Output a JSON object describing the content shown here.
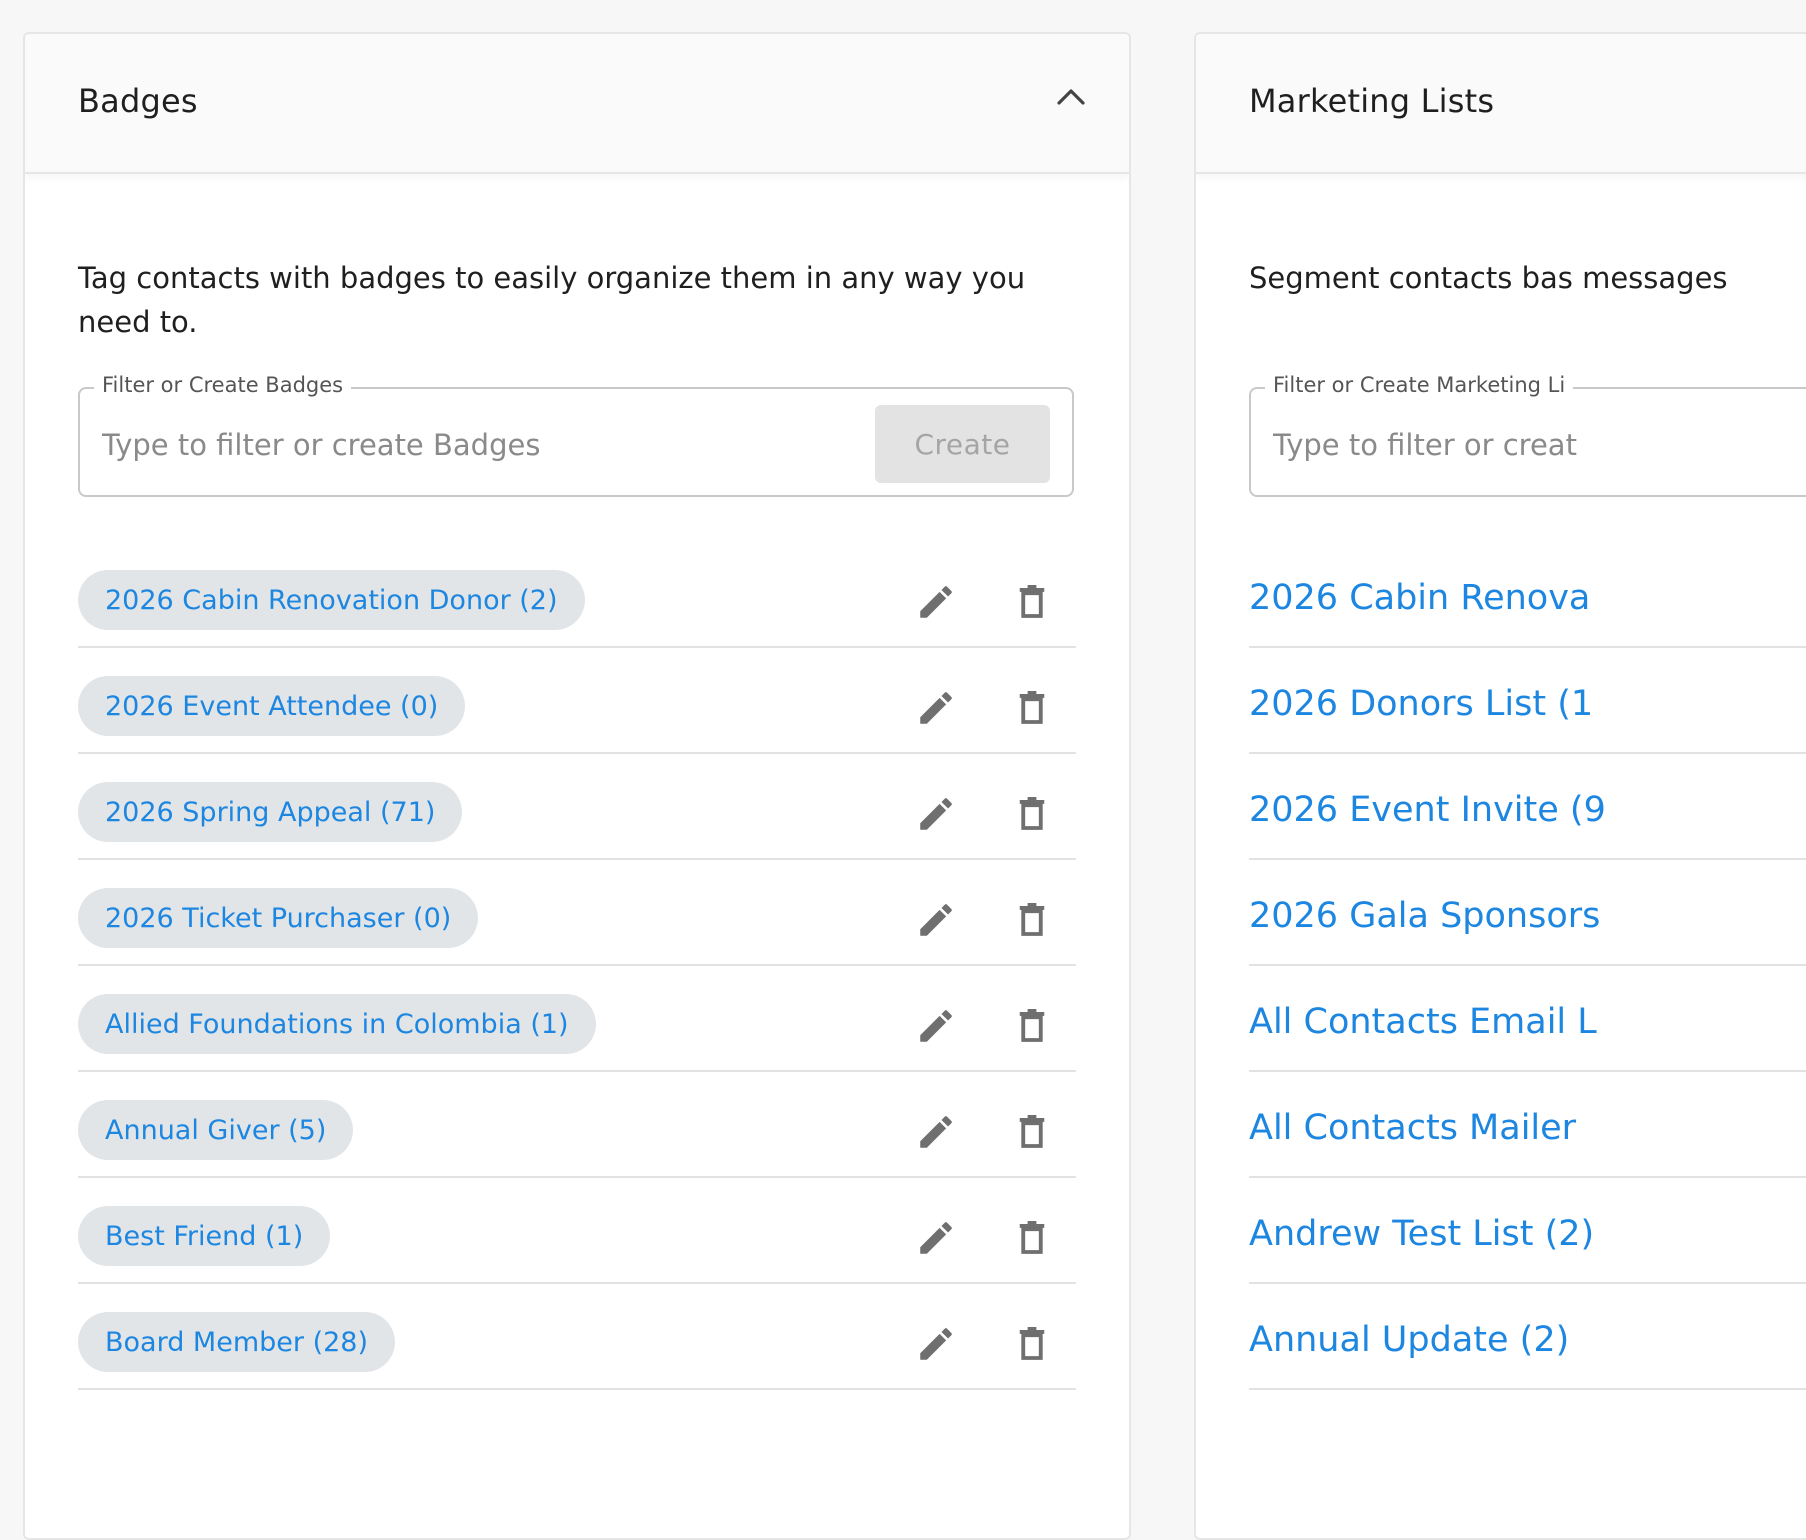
{
  "badges_panel": {
    "title": "Badges",
    "description": "Tag contacts with badges to easily organize them in any way you need to.",
    "filter": {
      "legend": "Filter or Create Badges",
      "placeholder": "Type to filter or create Badges",
      "value": "",
      "create_label": "Create"
    },
    "items": [
      {
        "label": "2026 Cabin Renovation Donor (2)"
      },
      {
        "label": "2026 Event Attendee (0)"
      },
      {
        "label": "2026 Spring Appeal (71)"
      },
      {
        "label": "2026 Ticket Purchaser (0)"
      },
      {
        "label": "Allied Foundations in Colombia (1)"
      },
      {
        "label": "Annual Giver (5)"
      },
      {
        "label": "Best Friend (1)"
      },
      {
        "label": "Board Member (28)"
      }
    ],
    "icons": {
      "collapse": "chevron-up-icon",
      "edit": "pencil-icon",
      "delete": "trash-icon"
    }
  },
  "marketing_panel": {
    "title": "Marketing Lists",
    "description": "Segment contacts bas messages",
    "filter": {
      "legend": "Filter or Create Marketing Li",
      "placeholder": "Type to filter or creat",
      "value": ""
    },
    "items": [
      {
        "label": "2026 Cabin Renova"
      },
      {
        "label": "2026 Donors List (1"
      },
      {
        "label": "2026 Event Invite (9"
      },
      {
        "label": "2026 Gala Sponsors"
      },
      {
        "label": "All Contacts Email L"
      },
      {
        "label": "All Contacts Mailer"
      },
      {
        "label": "Andrew Test List (2)"
      },
      {
        "label": "Annual Update (2)"
      }
    ]
  },
  "colors": {
    "accent": "#1c86e0",
    "chip_background": "#e2e5e8",
    "icon_gray": "#6f6f6f",
    "page_background": "#f7f7f7"
  }
}
